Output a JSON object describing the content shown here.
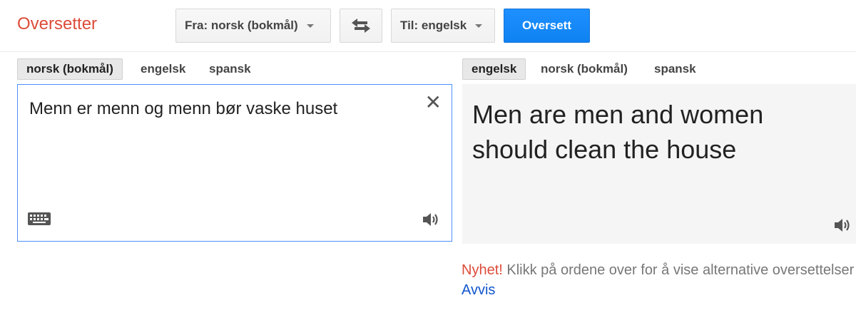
{
  "header": {
    "title": "Oversetter",
    "from_label": "Fra: norsk (bokmål)",
    "to_label": "Til: engelsk",
    "translate_label": "Oversett"
  },
  "source": {
    "tabs": [
      {
        "label": "norsk (bokmål)",
        "active": true
      },
      {
        "label": "engelsk",
        "active": false
      },
      {
        "label": "spansk",
        "active": false
      }
    ],
    "text": "Menn er menn og menn bør vaske huset"
  },
  "target": {
    "tabs": [
      {
        "label": "engelsk",
        "active": true
      },
      {
        "label": "norsk (bokmål)",
        "active": false
      },
      {
        "label": "spansk",
        "active": false
      }
    ],
    "text": "Men are men and women should clean the house"
  },
  "notice": {
    "new_label": "Nyhet!",
    "message": "Klikk på ordene over for å vise alternative oversettelser",
    "dismiss": "Avvis"
  },
  "colors": {
    "title": "#dd4b39",
    "primary_button": "#1a8cff",
    "link": "#1155cc"
  },
  "icons": {
    "swap": "swap-arrows-icon",
    "clear": "close-icon",
    "keyboard": "keyboard-icon",
    "speaker": "speaker-icon"
  }
}
